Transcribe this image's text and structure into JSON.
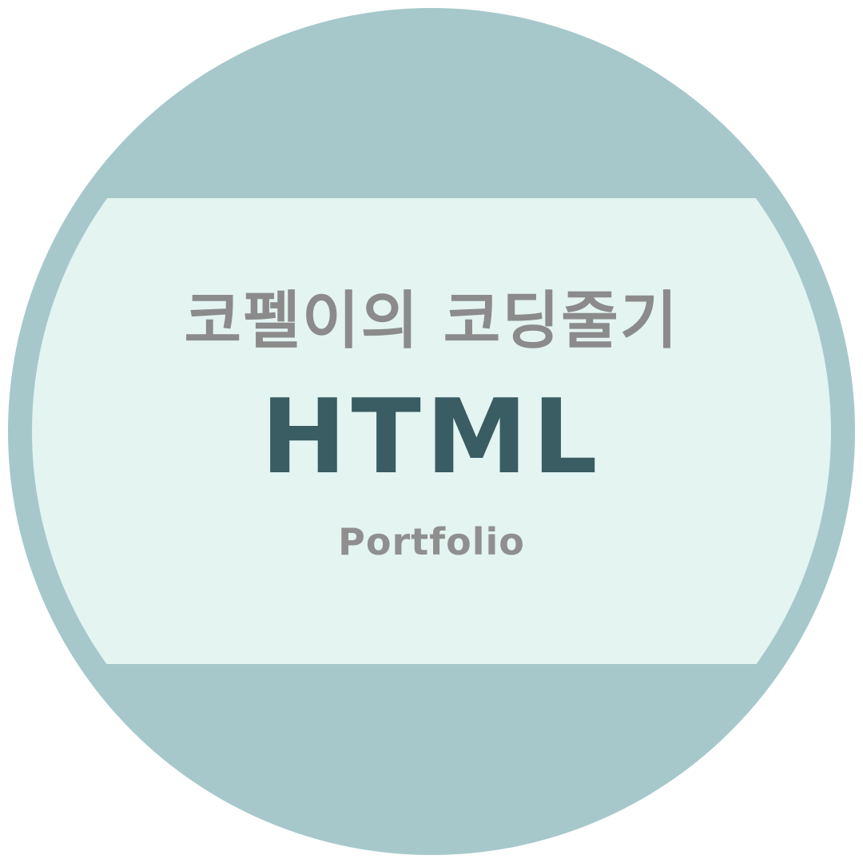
{
  "badge": {
    "subtitle": "코펠이의 코딩줄기",
    "title": "HTML",
    "tagline": "Portfolio"
  },
  "colors": {
    "ring": "#a6c8cb",
    "band": "#e3f4f1",
    "title": "#3a5c63",
    "muted_text": "#8b8b8b"
  }
}
